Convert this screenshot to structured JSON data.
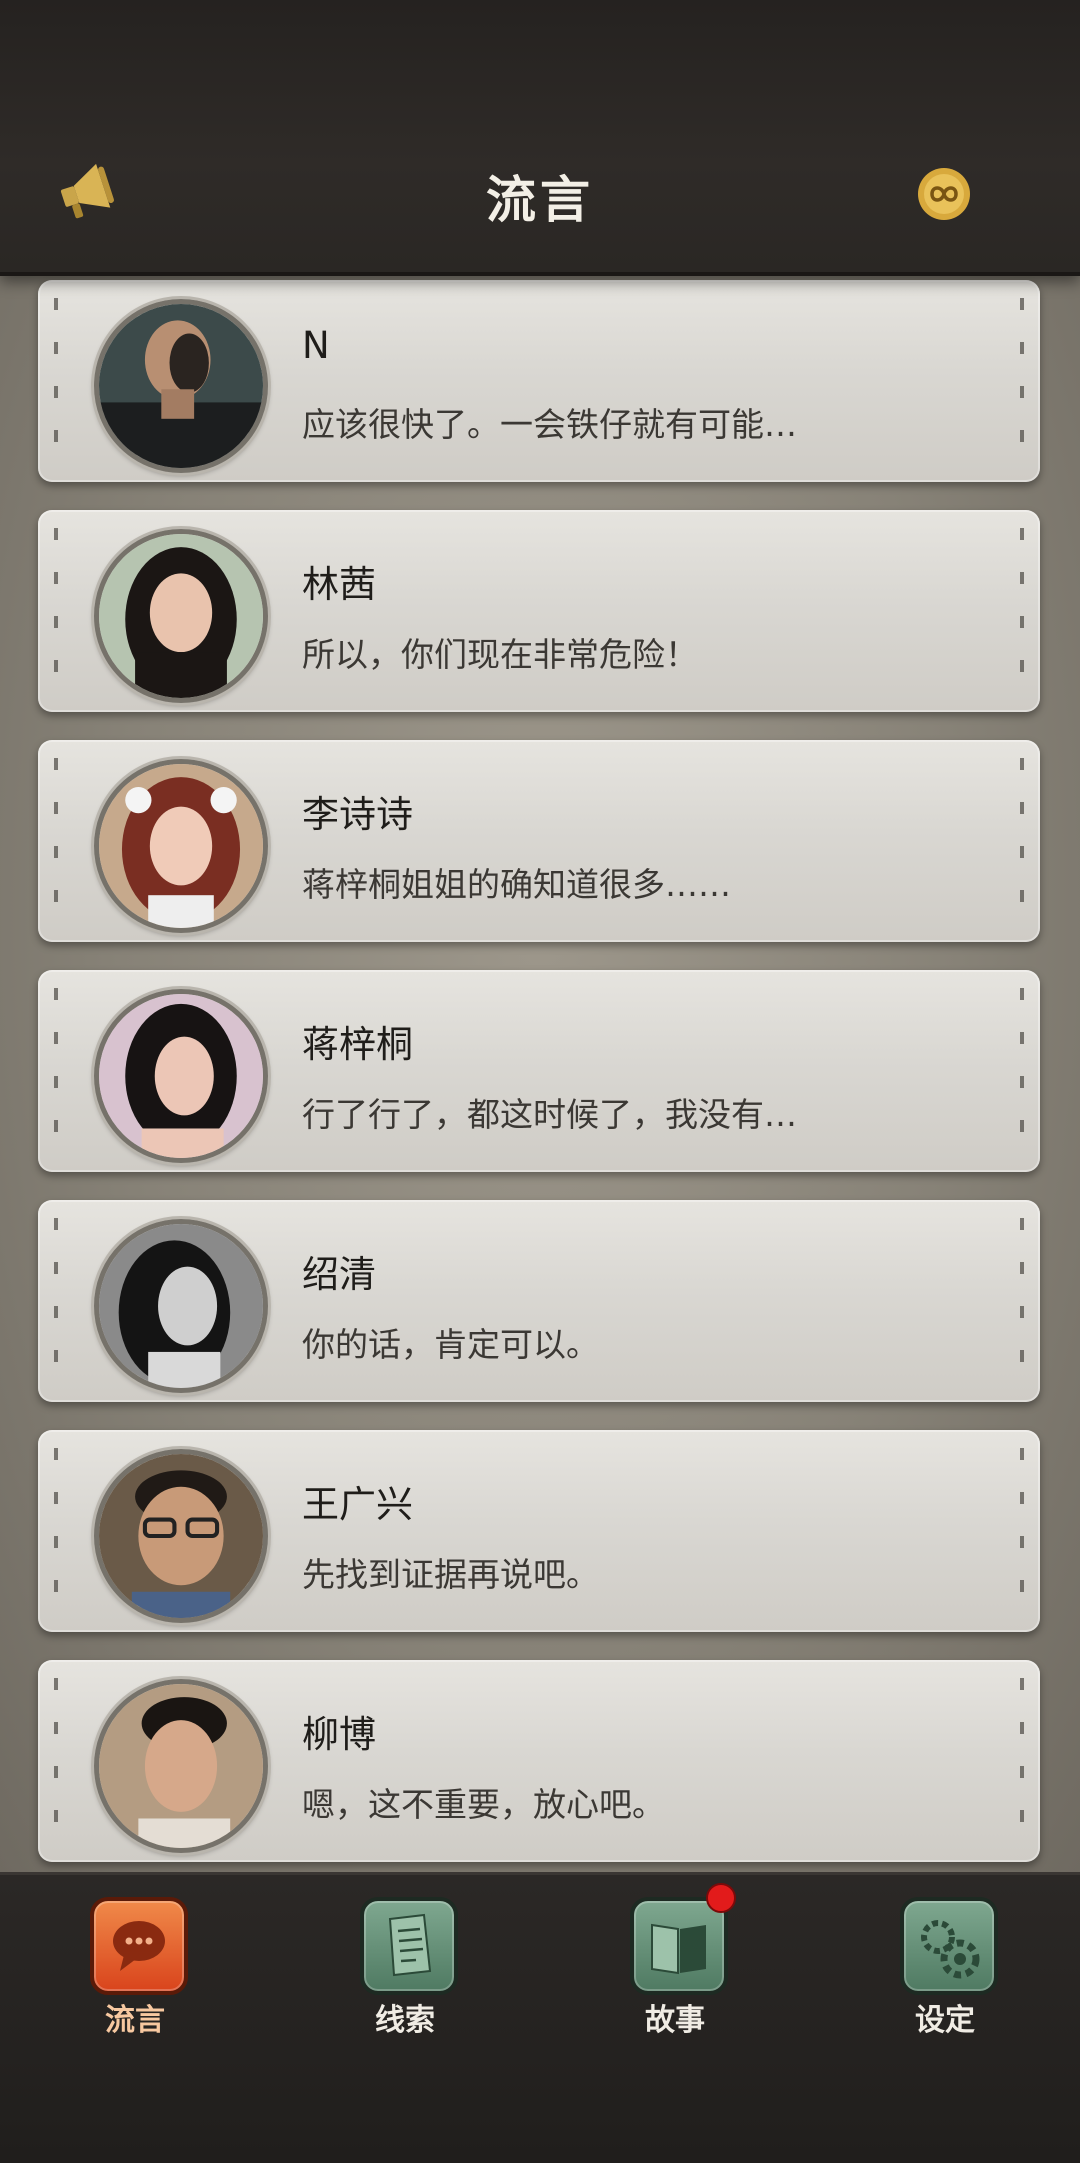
{
  "header": {
    "title": "流言",
    "left_icon": "megaphone-icon",
    "right_icon": "infinity-badge-icon"
  },
  "conversations": [
    {
      "name": "N",
      "message": "应该很快了。一会铁仔就有可能…"
    },
    {
      "name": "林茜",
      "message": "所以，你们现在非常危险！"
    },
    {
      "name": "李诗诗",
      "message": "蒋梓桐姐姐的确知道很多……"
    },
    {
      "name": "蒋梓桐",
      "message": "行了行了，都这时候了，我没有…"
    },
    {
      "name": "绍清",
      "message": "你的话，肯定可以。"
    },
    {
      "name": "王广兴",
      "message": "先找到证据再说吧。"
    },
    {
      "name": "柳博",
      "message": "嗯，这不重要，放心吧。"
    }
  ],
  "tabs": [
    {
      "label": "流言",
      "icon": "chat-bubble-icon",
      "active": true
    },
    {
      "label": "线索",
      "icon": "document-icon",
      "active": false
    },
    {
      "label": "故事",
      "icon": "book-icon",
      "active": false,
      "badge": true
    },
    {
      "label": "设定",
      "icon": "gear-icon",
      "active": false
    }
  ],
  "colors": {
    "accent": "#e4521f",
    "tab_inactive": "#5f8c72",
    "badge": "#e21b1b",
    "header_bg": "#2a2724",
    "card_bg": "#dcdad5"
  }
}
